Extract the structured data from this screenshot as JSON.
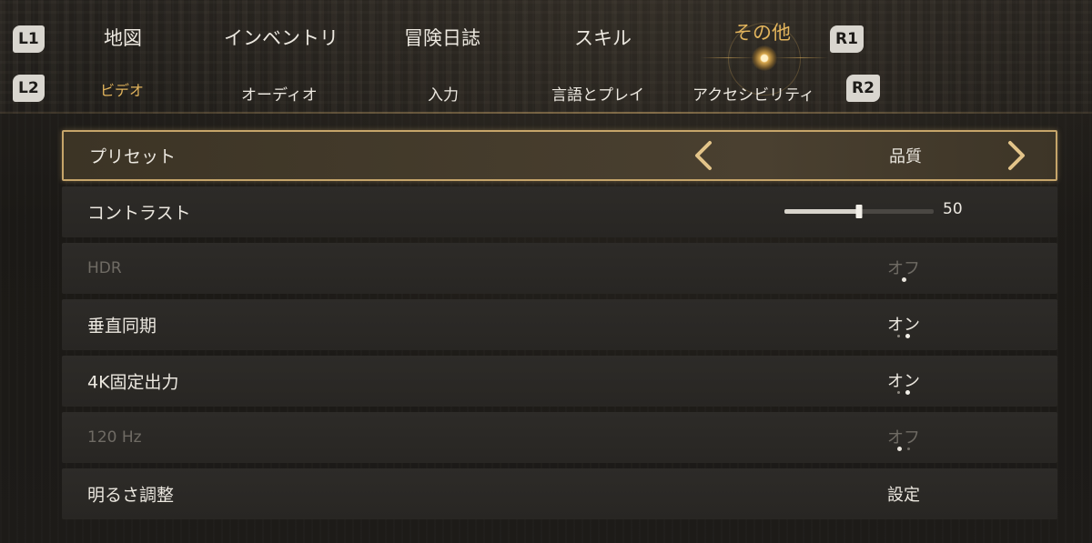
{
  "shoulder_buttons": {
    "l1": "L1",
    "r1": "R1",
    "l2": "L2",
    "r2": "R2"
  },
  "main_tabs": [
    {
      "label": "地図",
      "active": false
    },
    {
      "label": "インベントリ",
      "active": false
    },
    {
      "label": "冒険日誌",
      "active": false
    },
    {
      "label": "スキル",
      "active": false
    },
    {
      "label": "その他",
      "active": true
    }
  ],
  "sub_tabs": [
    {
      "label": "ビデオ",
      "active": true
    },
    {
      "label": "オーディオ",
      "active": false
    },
    {
      "label": "入力",
      "active": false
    },
    {
      "label": "言語とプレイ",
      "active": false
    },
    {
      "label": "アクセシビリティ",
      "active": false
    }
  ],
  "settings": [
    {
      "label": "プリセット",
      "value": "品質",
      "type": "selector",
      "selected": true
    },
    {
      "label": "コントラスト",
      "type": "slider",
      "slider_value": "50",
      "slider_fraction": 0.5
    },
    {
      "label": "HDR",
      "value": "オフ",
      "type": "toggle",
      "disabled": true,
      "option_count": 1,
      "option_index": 0
    },
    {
      "label": "垂直同期",
      "value": "オン",
      "type": "toggle",
      "option_count": 2,
      "option_index": 1
    },
    {
      "label": "4K固定出力",
      "value": "オン",
      "type": "toggle",
      "option_count": 2,
      "option_index": 1
    },
    {
      "label": "120 Hz",
      "value": "オフ",
      "type": "toggle",
      "disabled": true,
      "option_count": 2,
      "option_index": 0
    },
    {
      "label": "明るさ調整",
      "value": "設定",
      "type": "action"
    }
  ],
  "colors": {
    "accent": "#e2b45c",
    "selected_border": "#c6a56a",
    "row_bg": "#2d2b28",
    "disabled_text": "#6f6b64"
  }
}
